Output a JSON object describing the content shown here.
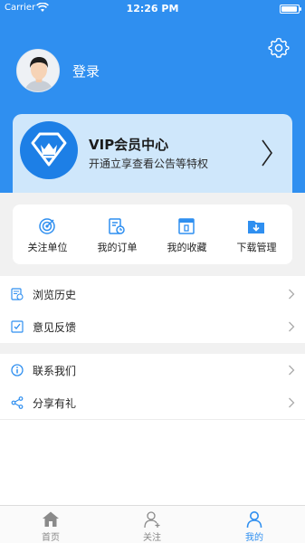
{
  "status_bar": {
    "carrier": "Carrier",
    "time": "12:26 PM",
    "battery_level": 0.95
  },
  "profile": {
    "login_label": "登录"
  },
  "vip": {
    "title": "VIP会员中心",
    "description": "开通立享查看公告等特权"
  },
  "quick_actions": [
    {
      "label": "关注单位",
      "icon": "target-icon"
    },
    {
      "label": "我的订单",
      "icon": "order-icon"
    },
    {
      "label": "我的收藏",
      "icon": "bookmark-icon"
    },
    {
      "label": "下载管理",
      "icon": "download-folder-icon"
    }
  ],
  "menu_group_1": [
    {
      "label": "浏览历史",
      "icon": "history-icon"
    },
    {
      "label": "意见反馈",
      "icon": "feedback-icon"
    }
  ],
  "menu_group_2": [
    {
      "label": "联系我们",
      "icon": "info-icon"
    },
    {
      "label": "分享有礼",
      "icon": "share-icon"
    }
  ],
  "tab_bar": {
    "tabs": [
      {
        "label": "首页",
        "icon": "home-icon"
      },
      {
        "label": "关注",
        "icon": "add-user-icon"
      },
      {
        "label": "我的",
        "icon": "user-icon"
      }
    ],
    "active_tab": "我的"
  },
  "colors": {
    "brand_blue": "#2f8ff0",
    "vip_card": "#cfe7fb",
    "background_gray": "#f1f1f1"
  }
}
